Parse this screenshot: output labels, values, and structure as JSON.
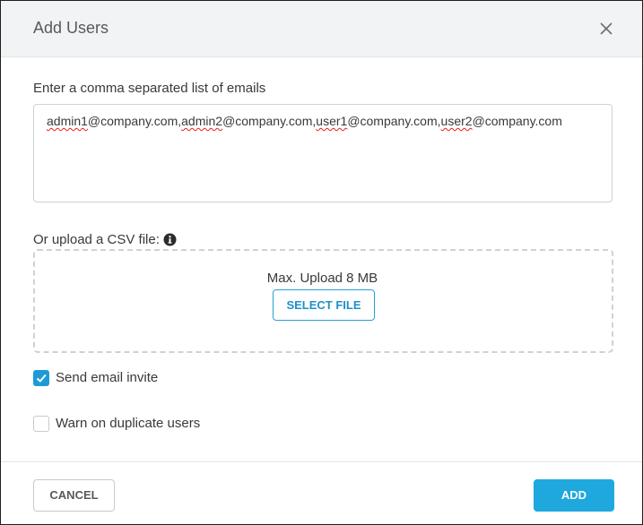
{
  "dialog": {
    "title": "Add Users",
    "close_icon": "close-icon"
  },
  "emails": {
    "label": "Enter a comma separated list of emails",
    "value": "admin1@company.com,admin2@company.com,user1@company.com,user2@company.com",
    "value_parts": [
      {
        "text": "admin1",
        "misspelled": true
      },
      {
        "text": "@company.com,",
        "misspelled": false
      },
      {
        "text": "admin2",
        "misspelled": true
      },
      {
        "text": "@company.com,",
        "misspelled": false
      },
      {
        "text": "user1",
        "misspelled": true
      },
      {
        "text": "@company.com,",
        "misspelled": false
      },
      {
        "text": "user2",
        "misspelled": true
      },
      {
        "text": "@company.com",
        "misspelled": false
      }
    ]
  },
  "upload": {
    "label": "Or upload a CSV file:",
    "info_icon": "info-icon",
    "limit_text": "Max. Upload 8 MB",
    "select_label": "SELECT FILE"
  },
  "options": {
    "send_invite": {
      "label": "Send email invite",
      "checked": true
    },
    "warn_duplicates": {
      "label": "Warn on duplicate users",
      "checked": false
    }
  },
  "actions": {
    "cancel_label": "CANCEL",
    "add_label": "ADD"
  },
  "colors": {
    "accent": "#1ea8de",
    "header_bg": "#f2f3f4",
    "text": "#39393b"
  }
}
